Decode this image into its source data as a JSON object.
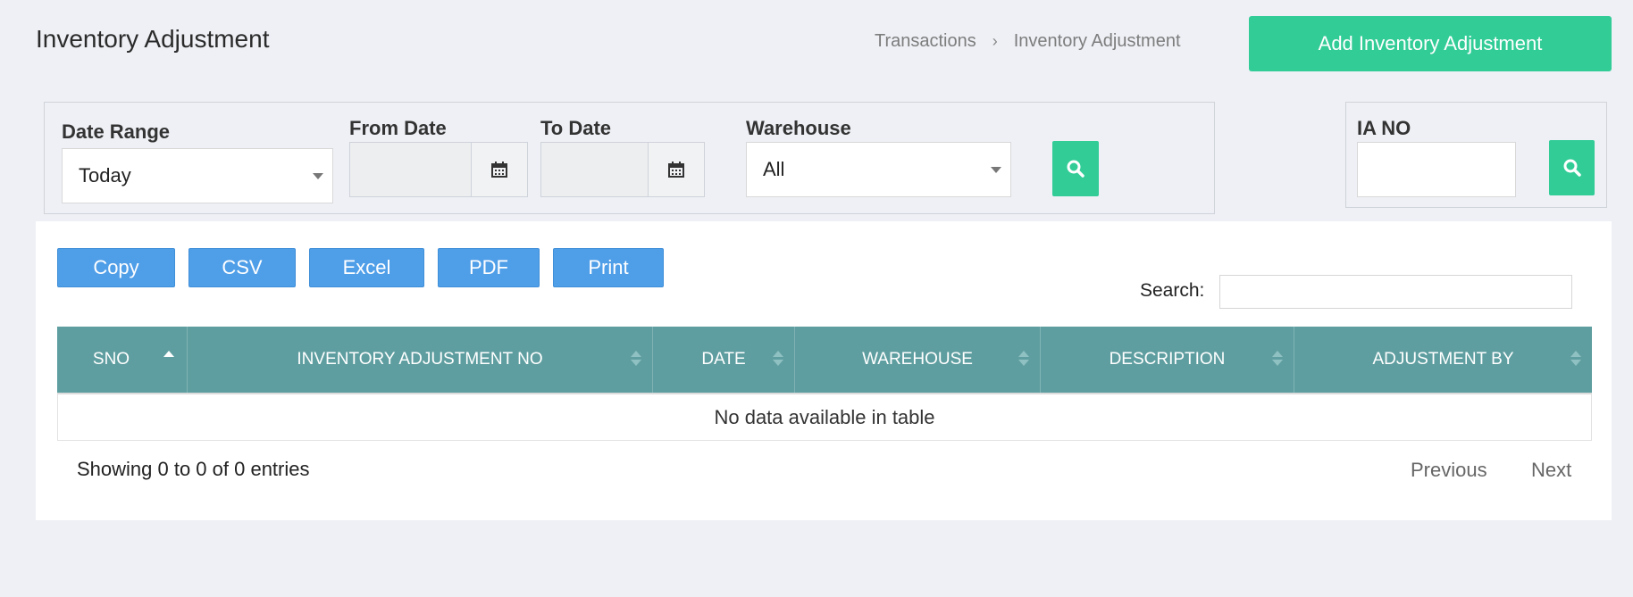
{
  "header": {
    "title": "Inventory Adjustment",
    "breadcrumb": [
      "Transactions",
      "Inventory Adjustment"
    ],
    "breadcrumb_sep": "›",
    "add_button": "Add Inventory Adjustment"
  },
  "filters": {
    "date_range_label": "Date Range",
    "date_range_value": "Today",
    "from_date_label": "From Date",
    "to_date_label": "To Date",
    "warehouse_label": "Warehouse",
    "warehouse_value": "All",
    "ia_no_label": "IA NO"
  },
  "toolbar": {
    "buttons": [
      "Copy",
      "CSV",
      "Excel",
      "PDF",
      "Print"
    ],
    "search_label": "Search:"
  },
  "table": {
    "columns": [
      "SNO",
      "INVENTORY ADJUSTMENT NO",
      "DATE",
      "WAREHOUSE",
      "DESCRIPTION",
      "ADJUSTMENT BY"
    ],
    "empty_text": "No data available in table",
    "info": "Showing 0 to 0 of 0 entries",
    "prev": "Previous",
    "next": "Next"
  },
  "colors": {
    "accent_green": "#32cc97",
    "button_blue": "#4f9ee8",
    "header_teal": "#5f9ea0"
  },
  "icons": {
    "calendar": "calendar-icon",
    "search": "search-icon",
    "dropdown": "caret-down-icon",
    "sort": "sort-icon"
  }
}
